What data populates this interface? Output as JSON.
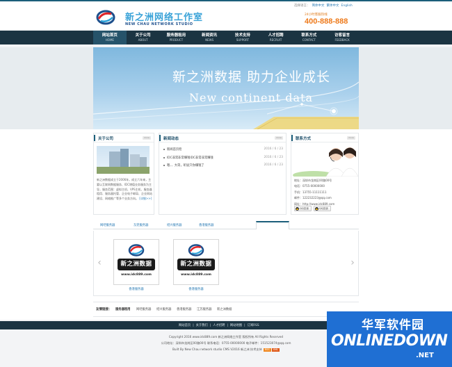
{
  "header": {
    "lang_label": "选择语言：",
    "lang_options": [
      "简体中文",
      "繁体中文",
      "English"
    ],
    "logo_cn": "新之洲网络工作室",
    "logo_en": "NEW CHAU NETWORK STUDIO",
    "hotline_label": "24小时客服热线",
    "hotline_number": "400-888-888"
  },
  "nav": [
    {
      "cn": "网站首页",
      "en": "HOME"
    },
    {
      "cn": "关于公司",
      "en": "ABOUT"
    },
    {
      "cn": "服务器租用",
      "en": "PRODUCT"
    },
    {
      "cn": "新闻资讯",
      "en": "NEWS"
    },
    {
      "cn": "技术支持",
      "en": "SUPPORT"
    },
    {
      "cn": "人才招聘",
      "en": "RECRUIT"
    },
    {
      "cn": "联系方式",
      "en": "CONTACT"
    },
    {
      "cn": "访客留言",
      "en": "FEEDBACK"
    }
  ],
  "banner": {
    "cn": "新之洲数据  助力企业成长",
    "en": "New continent data"
  },
  "about": {
    "title": "关于公司",
    "more": "more",
    "text": "新之洲数据成立于2006年，成立六年来，主要以互联网数据服务、IDC增值业务服务为主导，服务范围：虚拟主机、VPS主机、服务器租用、服务器托管、企业电子邮局、企业网站建设、网络推广等多个业务方向。",
    "read_more": "[详细>>]"
  },
  "news": {
    "title": "新闻动态",
    "more": "more",
    "items": [
      {
        "title": "新闻首页检",
        "date": "2016 / 6 / 23"
      },
      {
        "title": "IDC非常非常赚钱IDC非常非常赚钱",
        "date": "2016 / 6 / 23"
      },
      {
        "title": "嗯、、大哥，听说只你赚钱了",
        "date": "2016 / 6 / 23"
      }
    ]
  },
  "contact": {
    "title": "联系方式",
    "more": "more",
    "lines": [
      "地址：深圳市龙岗区00路00号",
      "电话：0755-00000000",
      "手机：13755-11111111",
      "邮件：122232223@qq.com",
      "网址：http://www.idc889.com"
    ],
    "qq_buttons": [
      "QQ交谈",
      "QQ交谈"
    ]
  },
  "tabs": [
    "网吧服务器",
    "东莞服务器",
    "绍兴服务器",
    "香港服务器"
  ],
  "products": {
    "items": [
      {
        "name": "新之洲数据",
        "url": "www.idc889.com",
        "caption": "香港服务器"
      },
      {
        "name": "新之洲数据",
        "url": "www.idc889.com",
        "caption": "香港服务器"
      }
    ],
    "prev": "‹",
    "next": "›"
  },
  "links": {
    "label": "友情链接：",
    "items": [
      "服务器租用",
      "网吧服务器",
      "绍兴服务器",
      "香港服务器",
      "江苏服务器",
      "新之洲数据"
    ]
  },
  "footer": {
    "nav": [
      "网站首页",
      "关于我们",
      "人才招聘",
      "网站地图",
      "订阅RSS"
    ],
    "copyright": "Copyright 2016 www.idc889.com 新之洲网络工作室 版权所有 All Rights Reserved",
    "address": "公司地址：深圳市龙岗区00路00号 联系电话：0755-00000000 电子邮件：151523074@qq.com",
    "built": "Built By New Chau network studio CMS V2016 新之洲 技术支持",
    "rss_badge": "RSS",
    "xml_badge": "XML"
  },
  "watermark": {
    "cn": "华军软件园",
    "en": "ONLINEDOWN",
    "suffix": ".NET"
  },
  "colors": {
    "nav_bg": "#1b3442",
    "accent": "#1b5e7a",
    "hotline": "#ee7a1b",
    "link": "#2a7bb5"
  }
}
